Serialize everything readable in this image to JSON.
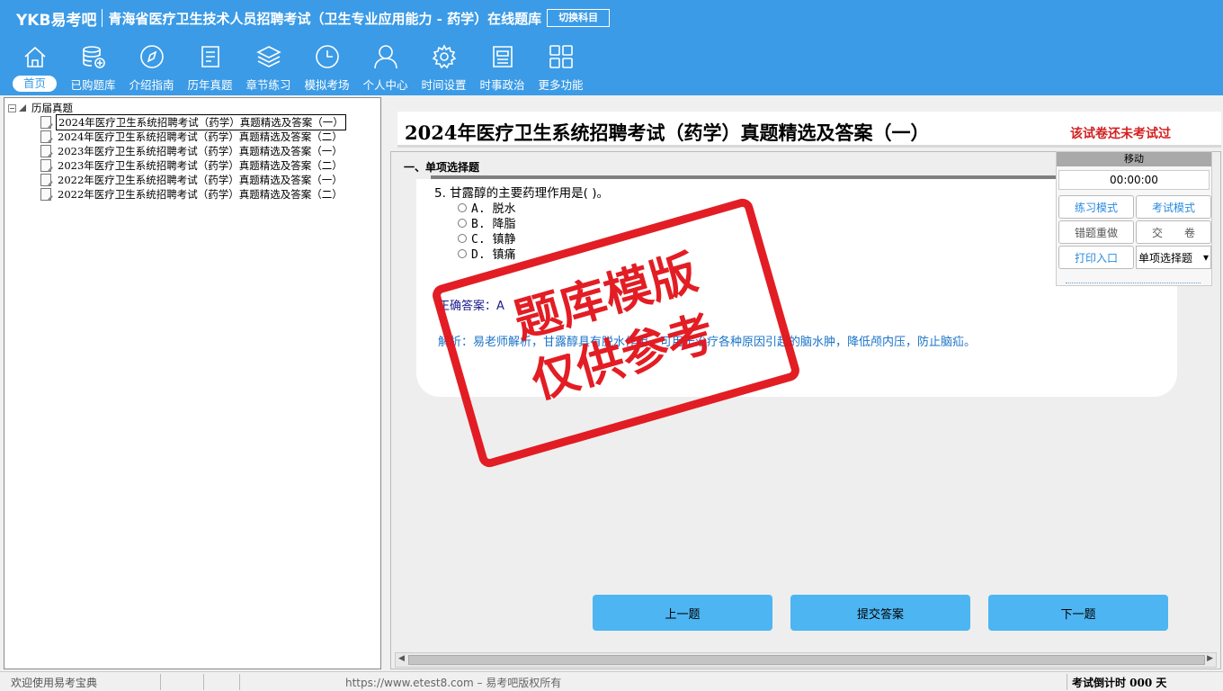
{
  "header": {
    "brand": "YKB易考吧",
    "title": "青海省医疗卫生技术人员招聘考试（卫生专业应用能力 - 药学）在线题库",
    "switch_label": "切换科目"
  },
  "nav": [
    {
      "label": "首页",
      "icon": "home-icon"
    },
    {
      "label": "已购题库",
      "icon": "database-icon"
    },
    {
      "label": "介绍指南",
      "icon": "compass-icon"
    },
    {
      "label": "历年真题",
      "icon": "document-list-icon"
    },
    {
      "label": "章节练习",
      "icon": "layers-icon"
    },
    {
      "label": "模拟考场",
      "icon": "clock-icon"
    },
    {
      "label": "个人中心",
      "icon": "user-icon"
    },
    {
      "label": "时间设置",
      "icon": "gear-icon"
    },
    {
      "label": "时事政治",
      "icon": "news-icon"
    },
    {
      "label": "更多功能",
      "icon": "grid-icon"
    }
  ],
  "tree": {
    "root": "历届真题",
    "items": [
      "2024年医疗卫生系统招聘考试（药学）真题精选及答案（一）",
      "2024年医疗卫生系统招聘考试（药学）真题精选及答案（二）",
      "2023年医疗卫生系统招聘考试（药学）真题精选及答案（一）",
      "2023年医疗卫生系统招聘考试（药学）真题精选及答案（二）",
      "2022年医疗卫生系统招聘考试（药学）真题精选及答案（一）",
      "2022年医疗卫生系统招聘考试（药学）真题精选及答案（二）"
    ]
  },
  "paper": {
    "title": "2024年医疗卫生系统招聘考试（药学）真题精选及答案（一）",
    "status": "该试卷还未考试过",
    "section": "一、单项选择题"
  },
  "question": {
    "text": "5. 甘露醇的主要药理作用是(   )。",
    "options": [
      "A. 脱水",
      "B. 降脂",
      "C. 镇静",
      "D. 镇痛"
    ],
    "answer": "正确答案：A",
    "analysis": "解析：易老师解析，甘露醇具有脱水作用，可用于治疗各种原因引起的脑水肿，降低颅内压，防止脑疝。"
  },
  "watermark": {
    "line1": "题库模版",
    "line2": "仅供参考"
  },
  "buttons": {
    "prev": "上一题",
    "submit": "提交答案",
    "next": "下一题"
  },
  "panel": {
    "move": "移动",
    "timer": "00:00:00",
    "practice_mode": "练习模式",
    "exam_mode": "考试模式",
    "wrong_redo": "错题重做",
    "hand_in": "交　　卷",
    "print": "打印入口",
    "type_select": "单项选择题"
  },
  "status": {
    "welcome": "欢迎使用易考宝典",
    "url": "https://www.etest8.com – 易考吧版权所有",
    "countdown": "考试倒计时 000 天"
  },
  "colors": {
    "accent": "#3b9be6",
    "button": "#4db5f2",
    "warning": "#d42020"
  }
}
